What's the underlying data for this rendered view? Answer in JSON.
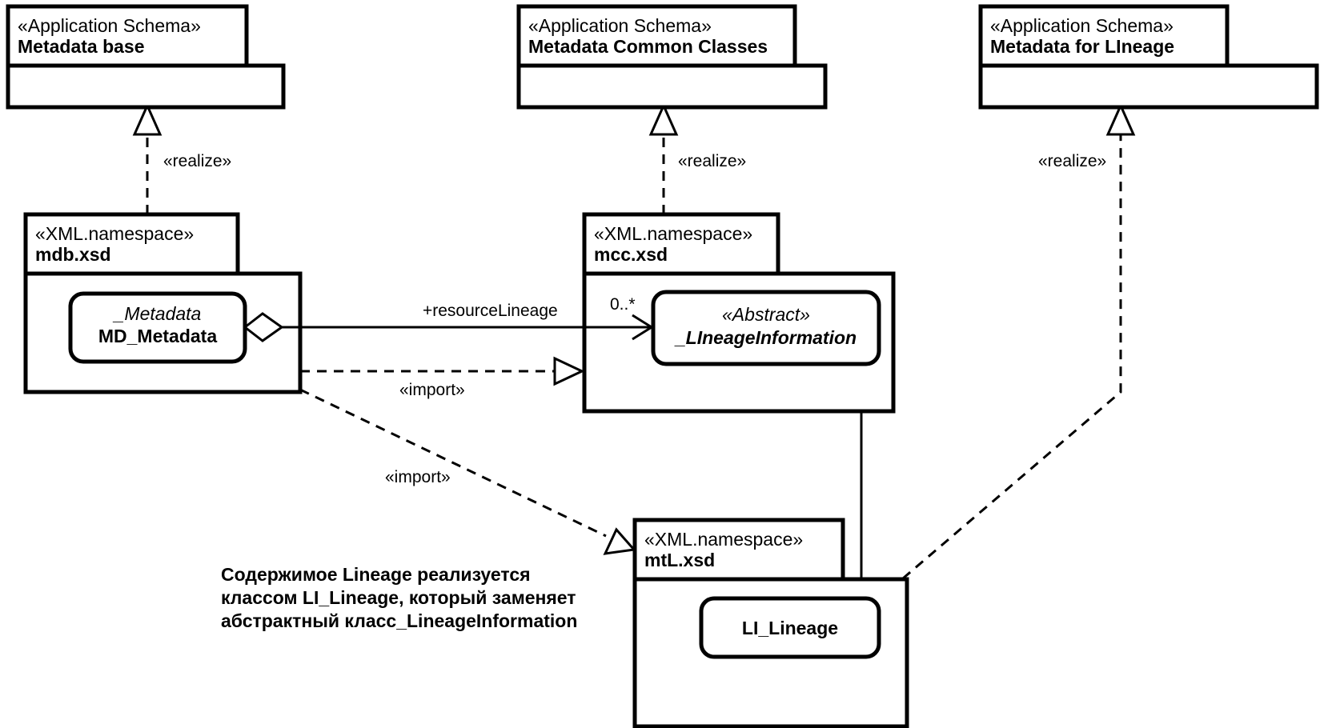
{
  "diagram": {
    "title": "UML package diagram: Metadata schema realization and imports",
    "background_color": "#ffffff",
    "line_color": "#000000"
  },
  "packages": [
    {
      "id": "metadata-base",
      "stereotype": "«Application Schema»",
      "name": "Metadata base"
    },
    {
      "id": "metadata-common-classes",
      "stereotype": "«Application Schema»",
      "name": "Metadata Common Classes"
    },
    {
      "id": "metadata-for-lineage",
      "stereotype": "«Application Schema»",
      "name": "Metadata for LIneage"
    },
    {
      "id": "mdb-xsd",
      "stereotype": "«XML.namespace»",
      "name": "mdb.xsd"
    },
    {
      "id": "mcc-xsd",
      "stereotype": "«XML.namespace»",
      "name": "mcc.xsd"
    },
    {
      "id": "mtl-xsd",
      "stereotype": "«XML.namespace»",
      "name": "mtL.xsd"
    }
  ],
  "classes": [
    {
      "id": "md-metadata",
      "stereotype": "_Metadata",
      "name": "MD_Metadata"
    },
    {
      "id": "lineage-information",
      "stereotype": "«Abstract»",
      "name": "_LIneageInformation"
    },
    {
      "id": "li-lineage",
      "stereotype": "",
      "name": "LI_Lineage"
    }
  ],
  "edges": [
    {
      "id": "realize-mdb",
      "label": "«realize»",
      "kind": "realize"
    },
    {
      "id": "realize-mcc",
      "label": "«realize»",
      "kind": "realize"
    },
    {
      "id": "realize-mtl",
      "label": "«realize»",
      "kind": "realize"
    },
    {
      "id": "import-mdb-mcc",
      "label": "«import»",
      "kind": "import"
    },
    {
      "id": "import-mdb-mtl",
      "label": "«import»",
      "kind": "import"
    }
  ],
  "association": {
    "id": "resource-lineage",
    "role_label": "+resourceLineage",
    "multiplicity": "0..*"
  },
  "note": {
    "id": "lineage-note",
    "lines": [
      "Содержимое Lineage реализуется",
      "классом LI_Lineage, который заменяет",
      "абстрактный класс_LineageInformation"
    ],
    "line1": "Содержимое Lineage реализуется",
    "line2": "классом LI_Lineage, который заменяет",
    "line3": "абстрактный класс_LineageInformation"
  }
}
